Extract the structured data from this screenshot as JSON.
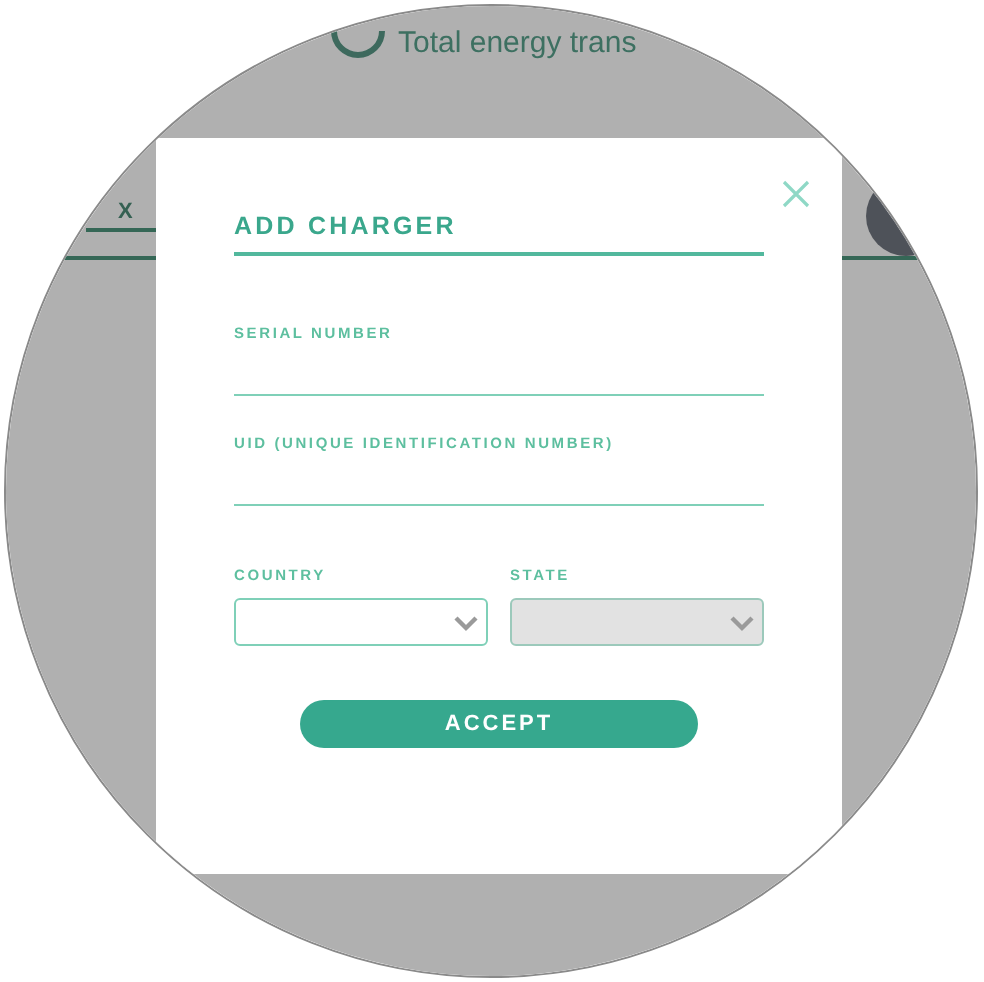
{
  "background": {
    "stat_label": "Total energy trans",
    "chip_label": "X"
  },
  "dialog": {
    "title": "ADD CHARGER",
    "fields": [
      {
        "label": "SERIAL NUMBER",
        "disabled": false
      },
      {
        "label": "UID (UNIQUE IDENTIFICATION NUMBER)",
        "disabled": false
      }
    ],
    "selects": [
      {
        "label": "COUNTRY",
        "disabled": false
      },
      {
        "label": "STATE",
        "disabled": true
      }
    ],
    "accept_button": "ACCEPT"
  }
}
